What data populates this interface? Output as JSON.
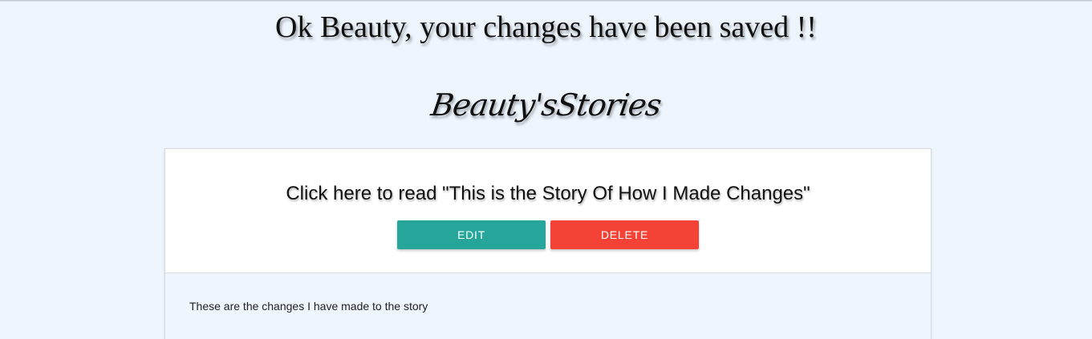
{
  "flash": {
    "message": "Ok Beauty, your changes have been saved !!"
  },
  "site": {
    "title": "Beauty'sStories"
  },
  "story": {
    "link_text": "Click here to read \"This is the Story Of How I Made Changes\"",
    "body": "These are the changes I have made to the story"
  },
  "actions": {
    "edit_label": "EDIT",
    "delete_label": "DELETE"
  },
  "colors": {
    "page_background": "#eef5fd",
    "edit_button": "#26a69a",
    "delete_button": "#f44336"
  }
}
